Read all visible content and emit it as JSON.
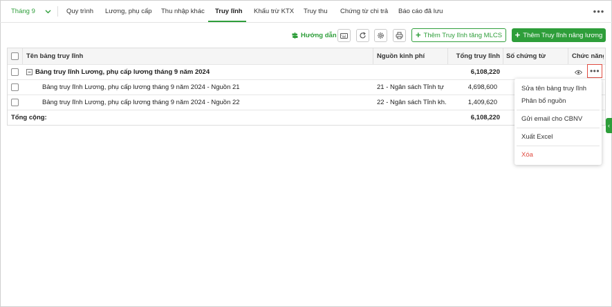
{
  "colors": {
    "accent": "#2e9e3a",
    "danger": "#e04a3f"
  },
  "header": {
    "month_selector": "Tháng 9",
    "tabs": [
      {
        "label": "Quy trình"
      },
      {
        "label": "Lương, phụ cấp"
      },
      {
        "label": "Thu nhập khác"
      },
      {
        "label": "Truy lĩnh",
        "active": true
      },
      {
        "label": "Khấu trừ KTX"
      },
      {
        "label": "Truy thu"
      },
      {
        "label": "Chứng từ chi trả"
      },
      {
        "label": "Báo cáo đã lưu"
      }
    ],
    "more_icon": "more-horizontal-icon"
  },
  "toolbar": {
    "guide_label": "Hướng dẫn",
    "icons": [
      "keyboard-icon",
      "refresh-icon",
      "settings-icon",
      "print-icon"
    ],
    "add_mlcs_label": "Thêm Truy lĩnh tăng MLCS",
    "add_raise_label": "Thêm Truy lĩnh nâng lương"
  },
  "table": {
    "columns": [
      "Tên bảng truy lĩnh",
      "Nguồn kinh phí",
      "Tổng truy lĩnh",
      "Số chứng từ",
      "Chức năng"
    ],
    "parent_row": {
      "name": "Bảng truy lĩnh Lương, phụ cấp lương tháng 9 năm 2024",
      "source": "",
      "total": "6,108,220",
      "doc_no": ""
    },
    "child_rows": [
      {
        "name": "Bảng truy lĩnh Lương, phụ cấp lương tháng 9 năm 2024 - Nguồn 21",
        "source": "21 - Ngân sách Tỉnh tự ...",
        "total": "4,698,600",
        "doc_no": ""
      },
      {
        "name": "Bảng truy lĩnh Lương, phụ cấp lương tháng 9 năm 2024 - Nguồn 22",
        "source": "22 - Ngân sách Tỉnh kh...",
        "total": "1,409,620",
        "doc_no": ""
      }
    ],
    "footer": {
      "label": "Tổng cộng:",
      "total": "6,108,220"
    }
  },
  "context_menu": {
    "items": [
      {
        "label": "Sửa tên bảng truy lĩnh"
      },
      {
        "label": "Phân bổ nguồn"
      },
      {
        "label": "Gửi email cho CBNV"
      },
      {
        "label": "Xuất Excel"
      },
      {
        "label": "Xóa",
        "danger": true
      }
    ]
  }
}
